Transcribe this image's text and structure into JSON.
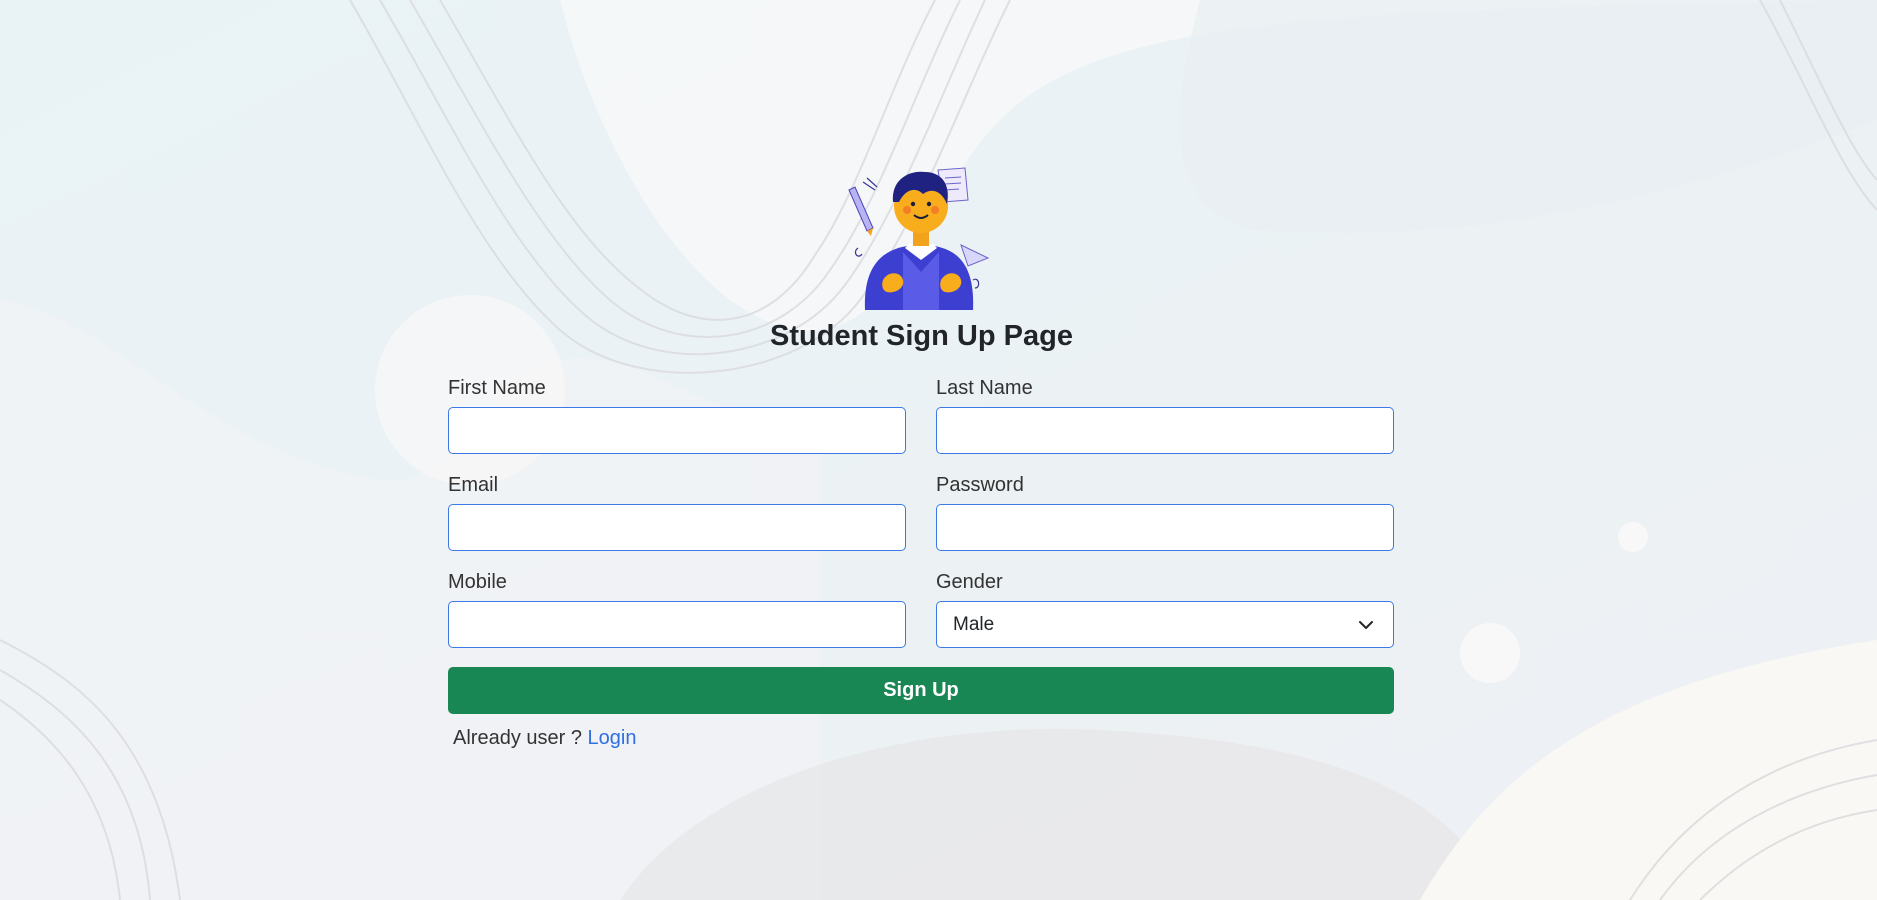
{
  "title": "Student Sign Up Page",
  "fields": {
    "first_name": {
      "label": "First Name",
      "value": ""
    },
    "last_name": {
      "label": "Last Name",
      "value": ""
    },
    "email": {
      "label": "Email",
      "value": ""
    },
    "password": {
      "label": "Password",
      "value": ""
    },
    "mobile": {
      "label": "Mobile",
      "value": ""
    },
    "gender": {
      "label": "Gender",
      "value": "Male"
    }
  },
  "signup_button": "Sign Up",
  "login_prompt": "Already user ?",
  "login_link": "Login",
  "colors": {
    "accent": "#198754",
    "input_border": "#3b79e8",
    "link": "#2f6fe0",
    "background": "#f1f2f4"
  },
  "icons": {
    "avatar": "student-illustration-icon",
    "dropdown": "chevron-down-icon"
  }
}
